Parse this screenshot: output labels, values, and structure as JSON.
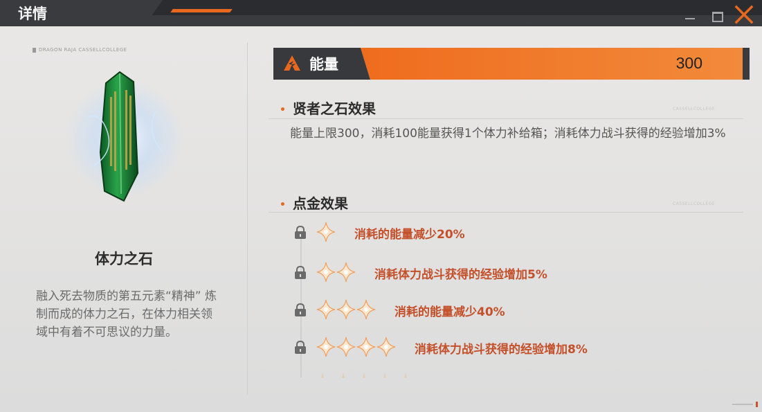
{
  "window": {
    "title": "详情"
  },
  "left": {
    "brand": "DRAGON RAJA CASSELLCOLLEGE",
    "item_name": "体力之石",
    "item_desc": "融入死去物质的第五元素“精神” 炼制而成的体力之石，在体力相关领域中有着不可思议的力量。"
  },
  "energy": {
    "label": "能量",
    "value": "300"
  },
  "sections": {
    "stone": {
      "title": "贤者之石效果",
      "text": "能量上限300，消耗100能量获得1个体力补给箱；消耗体力战斗获得的经验增加3%"
    },
    "gold": {
      "title": "点金效果",
      "tiers": [
        {
          "stars": 1,
          "text": "消耗的能量减少20%"
        },
        {
          "stars": 2,
          "text": "消耗体力战斗获得的经验增加5%"
        },
        {
          "stars": 3,
          "text": "消耗的能量减少40%"
        },
        {
          "stars": 4,
          "text": "消耗体力战斗获得的经验增加8%"
        }
      ]
    }
  },
  "watermark": "CASSELLCOLLEGE",
  "colors": {
    "accent": "#e8691e",
    "tier_text": "#c4502a"
  },
  "icons": [
    "close-icon",
    "minimize-icon",
    "maximize-icon",
    "lock-icon",
    "star-icon",
    "energy-icon"
  ]
}
